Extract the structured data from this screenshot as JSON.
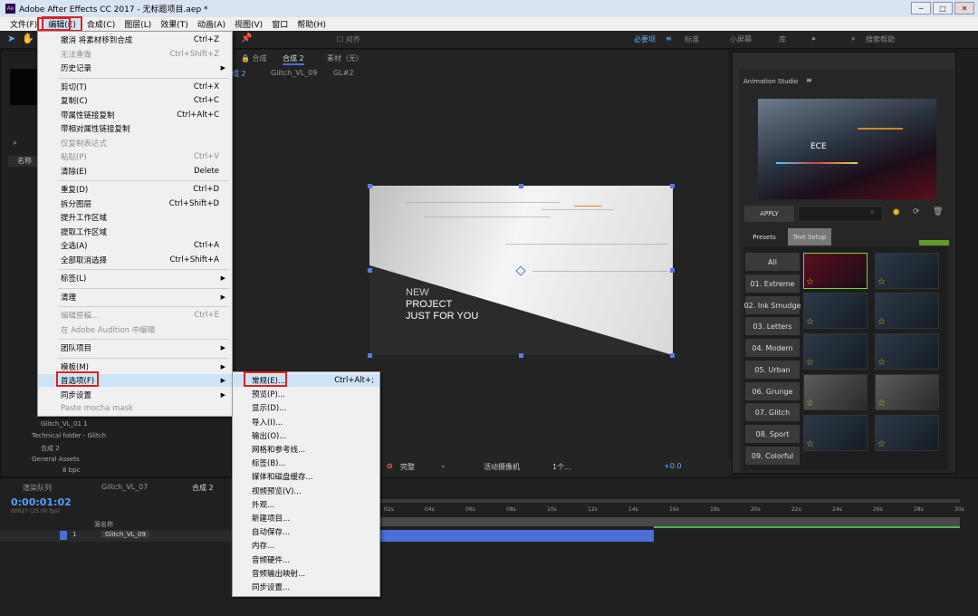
{
  "window": {
    "title": "Adobe After Effects CC 2017 - 无标题项目.aep *",
    "app_icon": "Ae",
    "minimize": "─",
    "maximize": "□",
    "close": "✕"
  },
  "menubar": [
    "文件(F)",
    "编辑(E)",
    "合成(C)",
    "图层(L)",
    "效果(T)",
    "动画(A)",
    "视图(V)",
    "窗口",
    "帮助(H)"
  ],
  "toolbar": {
    "snap": "对齐",
    "workspaces": [
      "必要项",
      "标准",
      "小屏幕",
      "库"
    ],
    "search_placeholder": "搜索帮助"
  },
  "comp_panel": {
    "tabs": [
      "合成",
      "合成 2",
      "素材（无）"
    ],
    "breadcrumb": [
      "成 2",
      "Glitch_VL_09",
      "GL#2"
    ],
    "canvas_lines": [
      "NEW",
      "PROJECT",
      "JUST FOR YOU"
    ],
    "footer": {
      "quality": "完整",
      "camera": "活动摄像机",
      "views": "1个...",
      "exposure": "+0.0"
    }
  },
  "project_panel": {
    "col_name": "名称",
    "items": [
      "Glitch_VL_01 1",
      "Technical folder - Glitch",
      "合成 2",
      "General Assets"
    ],
    "bpc": "8 bpc"
  },
  "edit_menu": [
    {
      "label": "撤消 将素材移到合成",
      "shortcut": "Ctrl+Z"
    },
    {
      "label": "无法重做",
      "shortcut": "Ctrl+Shift+Z",
      "disabled": true
    },
    {
      "label": "历史记录",
      "submenu": true
    },
    {
      "sep": true
    },
    {
      "label": "剪切(T)",
      "shortcut": "Ctrl+X"
    },
    {
      "label": "复制(C)",
      "shortcut": "Ctrl+C"
    },
    {
      "label": "带属性链接复制",
      "shortcut": "Ctrl+Alt+C"
    },
    {
      "label": "带相对属性链接复制"
    },
    {
      "label": "仅复制表达式",
      "disabled": true
    },
    {
      "label": "粘贴(P)",
      "shortcut": "Ctrl+V",
      "disabled": true
    },
    {
      "label": "清除(E)",
      "shortcut": "Delete"
    },
    {
      "sep": true
    },
    {
      "label": "重复(D)",
      "shortcut": "Ctrl+D"
    },
    {
      "label": "拆分图层",
      "shortcut": "Ctrl+Shift+D"
    },
    {
      "label": "提升工作区域"
    },
    {
      "label": "提取工作区域"
    },
    {
      "label": "全选(A)",
      "shortcut": "Ctrl+A"
    },
    {
      "label": "全部取消选择",
      "shortcut": "Ctrl+Shift+A"
    },
    {
      "sep": true
    },
    {
      "label": "标签(L)",
      "submenu": true
    },
    {
      "sep": true
    },
    {
      "label": "清理",
      "submenu": true
    },
    {
      "sep": true
    },
    {
      "label": "编辑原稿...",
      "shortcut": "Ctrl+E",
      "disabled": true
    },
    {
      "label": "在 Adobe Audition 中编辑",
      "disabled": true
    },
    {
      "sep": true
    },
    {
      "label": "团队项目",
      "submenu": true
    },
    {
      "sep": true
    },
    {
      "label": "模板(M)",
      "submenu": true
    },
    {
      "label": "首选项(F)",
      "submenu": true,
      "highlight": true
    },
    {
      "label": "同步设置",
      "submenu": true
    },
    {
      "label": "Paste mocha mask",
      "disabled": true
    }
  ],
  "prefs_submenu": [
    {
      "label": "常规(E)...",
      "shortcut": "Ctrl+Alt+;",
      "highlight": true
    },
    {
      "label": "预览(P)..."
    },
    {
      "label": "显示(D)..."
    },
    {
      "label": "导入(I)..."
    },
    {
      "label": "输出(O)..."
    },
    {
      "label": "网格和参考线..."
    },
    {
      "label": "标签(B)..."
    },
    {
      "label": "媒体和磁盘缓存..."
    },
    {
      "label": "视频预览(V)..."
    },
    {
      "label": "外观..."
    },
    {
      "label": "新建项目..."
    },
    {
      "label": "自动保存..."
    },
    {
      "label": "内存..."
    },
    {
      "label": "音频硬件..."
    },
    {
      "label": "音频输出映射..."
    },
    {
      "label": "同步设置..."
    }
  ],
  "studio": {
    "title": "Animation Studio",
    "apply": "APPLY",
    "tabs": [
      "Presets",
      "Text Setup"
    ],
    "preview_text": "ECE",
    "presets": [
      "All",
      "01. Extreme",
      "02. Ink Smudge",
      "03. Letters",
      "04. Modern",
      "05. Urban",
      "06. Grunge",
      "07. Glitch",
      "08. Sport",
      "09. Colorful"
    ],
    "accent": "#7fd23a"
  },
  "timeline": {
    "tabs": [
      "渲染队列",
      "Glitch_VL_07",
      "合成 2"
    ],
    "timecode": "0:00:01:02",
    "fps": "00027 (25.00 fps)",
    "col_source": "源名称",
    "layer_num": "1",
    "layer_name": "Glitch_VL_09",
    "ruler": [
      "02s",
      "04s",
      "06s",
      "08s",
      "10s",
      "12s",
      "14s",
      "16s",
      "18s",
      "20s",
      "22s",
      "24s",
      "26s",
      "28s",
      "30s"
    ],
    "accent": "#4b6fd8"
  }
}
